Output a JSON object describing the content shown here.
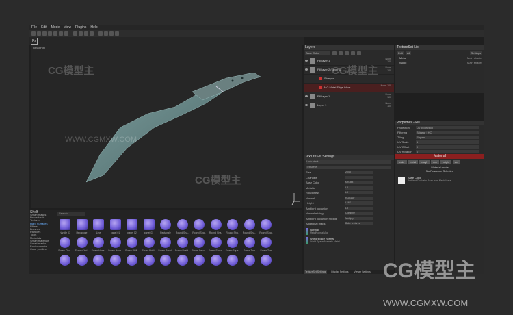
{
  "menu": [
    "File",
    "Edit",
    "Mode",
    "View",
    "Plugins",
    "Help"
  ],
  "toolbar2": {
    "ps_label": "Ps"
  },
  "viewport": {
    "label": "Material"
  },
  "shelf": {
    "title": "Shelf",
    "search_placeholder": "Search",
    "categories": [
      "Smart masks",
      "Procedurals",
      "Textures",
      "Hard Surfaces",
      "Filters",
      "Brushes",
      "Particles",
      "Tools",
      "Materials",
      "Smart materials",
      "Smart masks",
      "Environments",
      "Color profiles"
    ],
    "selected_category": 3,
    "tiles": [
      [
        "Handle 03",
        "Hexagone",
        "Line",
        "panel 01",
        "panel 02",
        "panel 03",
        "Rectangle",
        "Round Sha..",
        "Round Sha..",
        "Round Sha..",
        "Round Sha..",
        "Round Sha..",
        "Round Sha.."
      ],
      [
        "Screw Circl..",
        "Screw Circl..",
        "Screw Hexa..",
        "Screw Hexa..",
        "Screw Philli..",
        "Screw Philli..",
        "Screw Posid..",
        "Screw Posid..",
        "Screw Secur..",
        "Screw Secur..",
        "Screw Squa..",
        "Screw Torx",
        "Screw Torx"
      ],
      [
        "",
        "",
        "",
        "",
        "",
        "",
        "",
        "",
        "",
        "",
        "",
        "",
        ""
      ]
    ]
  },
  "layers": {
    "title": "Layers",
    "dropdown": "Base Color",
    "rows": [
      {
        "name": "Fill layer 1",
        "blend": "Norm\n100",
        "type": "fill"
      },
      {
        "name": "Fill layer 2 (Layer 1)",
        "blend": "Norm\n100",
        "type": "fill"
      },
      {
        "name": "Sharpen",
        "blend": "",
        "type": "sub"
      },
      {
        "name": "MG Metal Edge Wear",
        "blend": "Norm 100",
        "type": "sub-red"
      },
      {
        "name": "Fill layer 1",
        "blend": "Norm\n100",
        "type": "fill"
      },
      {
        "name": "Layer 1",
        "blend": "Norm\n100",
        "type": "paint"
      }
    ]
  },
  "texture_set_list": {
    "title": "TextureSet List",
    "buttons": [
      "Edit",
      "All"
    ],
    "settings_label": "Settings",
    "rows": [
      {
        "name": "Metal",
        "shader": "Main shader"
      },
      {
        "name": "Wood",
        "shader": "Main shader"
      }
    ]
  },
  "properties": {
    "title": "Properties - Fill",
    "rows": [
      {
        "label": "Projection",
        "value": "UV projection"
      },
      {
        "label": "Filtering",
        "value": "Bilinear | HQ"
      },
      {
        "label": "Tiling",
        "value": "Repeat"
      },
      {
        "label": "UV Scale",
        "value": "1"
      },
      {
        "label": "UV Offset",
        "value": "0"
      },
      {
        "label": "UV Rotation",
        "value": "0"
      }
    ],
    "material_label": "Material",
    "channels": [
      "color",
      "metal",
      "rough",
      "nrm",
      "height",
      "ao"
    ],
    "material_mode": "Material mode",
    "no_resource": "No Resource Selected",
    "base_color_title": "Base Color",
    "base_color_sub": "Ambient Occlusion Map from Mesh Metal"
  },
  "texture_set_settings": {
    "title": "TextureSet Settings",
    "rows": [
      {
        "label": "Undo stack",
        "value": "",
        "full": true
      },
      {
        "label": "Textureset",
        "value": "",
        "full": true
      },
      {
        "label": "Size",
        "value": "2048"
      },
      {
        "label": "Channels",
        "value": ""
      },
      {
        "label": "Base Color",
        "value": "sRGB8"
      },
      {
        "label": "Metallic",
        "value": "L8"
      },
      {
        "label": "Roughness",
        "value": "L8"
      },
      {
        "label": "Normal",
        "value": "RGB16F"
      },
      {
        "label": "Height",
        "value": "L16F"
      },
      {
        "label": "Ambient occlusion",
        "value": "L8"
      },
      {
        "label": "Normal mixing",
        "value": "Combine"
      },
      {
        "label": "Ambient occlusion mixing",
        "value": "Multiply"
      },
      {
        "label": "Additional maps",
        "value": "Bake textures"
      }
    ],
    "maps": [
      {
        "title": "Normal",
        "sub": "MetalNormalMap"
      },
      {
        "title": "World space normal",
        "sub": "World Space Normals Metal"
      }
    ],
    "tabs": [
      "TextureSet Settings",
      "Display Settings",
      "Viewer Settings"
    ]
  },
  "watermark": {
    "logo": "CG模型主",
    "url": "WWW.CGMXW.COM"
  }
}
